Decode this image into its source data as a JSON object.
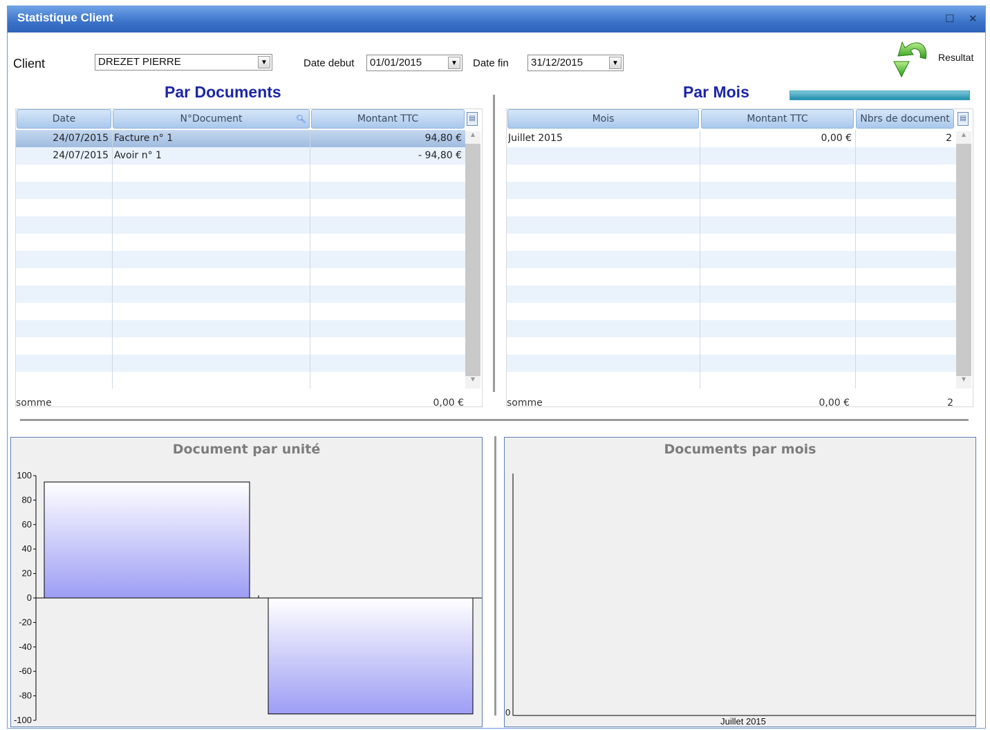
{
  "window": {
    "title": "Statistique Client",
    "maximize_glyph": "☐",
    "close_glyph": "✕"
  },
  "filters": {
    "client_label": "Client",
    "client_value": "DREZET PIERRE",
    "date_debut_label": "Date debut",
    "date_debut_value": "01/01/2015",
    "date_fin_label": "Date fin",
    "date_fin_value": "31/12/2015",
    "resultat_label": "Resultat",
    "resultat_icon": "green-curved-arrow-icon"
  },
  "par_documents": {
    "title": "Par Documents",
    "columns": [
      "Date",
      "N°Document",
      "Montant TTC"
    ],
    "rows": [
      {
        "date": "24/07/2015",
        "document": "Facture n° 1",
        "montant": "94,80 €"
      },
      {
        "date": "24/07/2015",
        "document": "Avoir n° 1",
        "montant": "- 94,80 €"
      }
    ],
    "somme_label": "somme",
    "somme_montant": "0,00 €"
  },
  "par_mois": {
    "title": "Par Mois",
    "columns": [
      "Mois",
      "Montant TTC",
      "Nbrs de document"
    ],
    "rows": [
      {
        "mois": "Juillet 2015",
        "montant": "0,00 €",
        "nbrs": "2"
      }
    ],
    "somme_label": "somme",
    "somme_montant": "0,00 €",
    "somme_nbrs": "2"
  },
  "colors": {
    "title_bar": "#3a73c9",
    "section_title": "#1c26a6",
    "bar_top": "#ffffff",
    "bar_bottom": "#9d9df5"
  },
  "chart_data": [
    {
      "type": "bar",
      "title": "Document par unité",
      "categories": [
        "Facture n° 1",
        "Avoir n° 1"
      ],
      "values": [
        94.8,
        -94.8
      ],
      "ylim": [
        -100,
        100
      ],
      "yticks": [
        100,
        80,
        60,
        40,
        20,
        0,
        -20,
        -40,
        -60,
        -80,
        -100
      ],
      "grid": false
    },
    {
      "type": "bar",
      "title": "Documents par mois",
      "categories": [
        "Juillet 2015"
      ],
      "values": [
        0
      ],
      "yticks": [
        0
      ],
      "grid": false
    }
  ]
}
